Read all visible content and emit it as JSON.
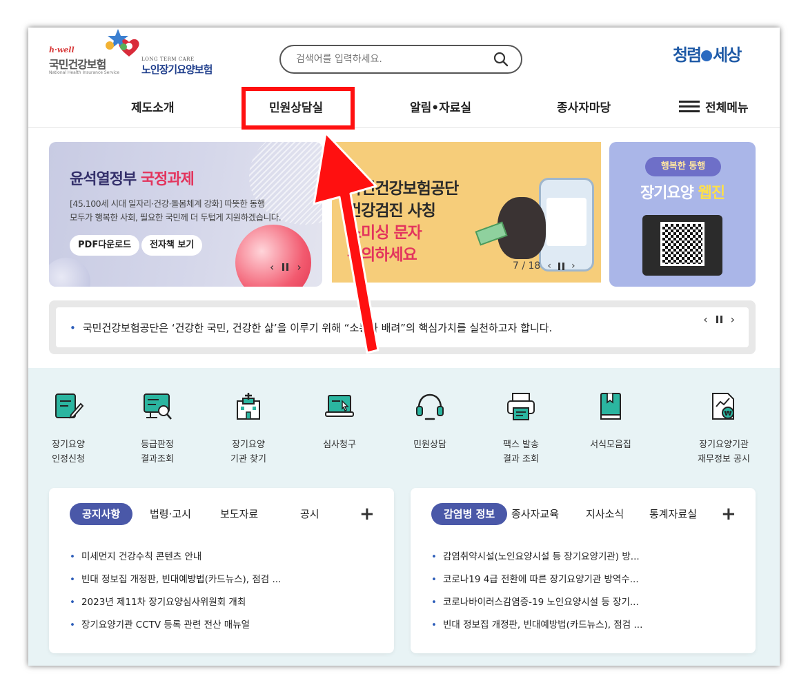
{
  "header": {
    "logo_nhis": {
      "tagline": "h·well",
      "name": "국민건강보험",
      "english": "National Health Insurance Service"
    },
    "logo_ltc": {
      "english": "LONG TERM CARE",
      "name": "노인장기요양보험"
    },
    "logo_right": {
      "part1": "청렴",
      "part2": "세상"
    },
    "search": {
      "placeholder": "검색어를 입력하세요."
    },
    "nav": [
      "제도소개",
      "민원상담실",
      "알림•자료실",
      "종사자마당"
    ],
    "menu_all": "전체메뉴"
  },
  "banners": {
    "left": {
      "title_plain": "윤석열정부",
      "title_emphasis": "국정과제",
      "line1": "[45.100세 시대 일자리·건강·돌봄체계 강화] 따뜻한 동행",
      "line2": "모두가 행복한 사회, 필요한 국민께 더 두텁게 지원하겠습니다.",
      "button1": "PDF다운로드",
      "button2": "전자책 보기"
    },
    "center": {
      "line1": "국민건강보험공단",
      "line2": "건강검진 사칭",
      "line3": "스미싱 문자",
      "line4": "주의하세요",
      "counter": "7 / 18"
    },
    "right": {
      "pill": "행복한 동행",
      "title_plain": "장기요양",
      "title_emphasis": "웹진"
    }
  },
  "ticker": {
    "text": "국민건강보험공단은 ‘건강한 국민, 건강한 삶’을 이루기 위해 “소통과 배려”의 핵심가치를 실천하고자 합니다."
  },
  "quick_menu": [
    {
      "label": "장기요양\n인정신청",
      "icon": "document-pencil-icon"
    },
    {
      "label": "등급판정\n결과조회",
      "icon": "monitor-search-icon"
    },
    {
      "label": "장기요양\n기관 찾기",
      "icon": "hospital-icon"
    },
    {
      "label": "심사청구",
      "icon": "laptop-cursor-icon"
    },
    {
      "label": "민원상담",
      "icon": "headset-icon"
    },
    {
      "label": "팩스 발송\n결과 조회",
      "icon": "fax-icon"
    },
    {
      "label": "서식모음집",
      "icon": "book-icon"
    },
    {
      "label": "장기요양기관\n재무정보 공시",
      "icon": "finance-doc-icon"
    }
  ],
  "board_left": {
    "tabs": [
      "공지사항",
      "법령·고시",
      "보도자료",
      "공시"
    ],
    "active_tab": "공지사항",
    "items": [
      "미세먼지 건강수칙 콘텐츠 안내",
      "빈대 정보집 개정판, 빈대예방법(카드뉴스), 점검 ...",
      "2023년 제11차 장기요양심사위원회 개최",
      "장기요양기관 CCTV 등록 관련 전산 매뉴얼"
    ]
  },
  "board_right": {
    "tabs": [
      "감염병 정보",
      "종사자교육",
      "지사소식",
      "통계자료실"
    ],
    "active_tab": "감염병 정보",
    "items": [
      "감염취약시설(노인요양시설 등 장기요양기관) 방...",
      "코로나19 4급 전환에 따른 장기요양기관 방역수...",
      "코로나바이러스감염증-19 노인요양시설 등 장기...",
      "빈대 정보집 개정판, 빈대예방법(카드뉴스), 점검 ..."
    ]
  },
  "colors": {
    "accent": "#4a58a8",
    "highlight_box": "#ff1010",
    "arrow": "#ff1010",
    "quick_bg": "#e8f3f5",
    "icon_teal": "#2bb5a0"
  }
}
